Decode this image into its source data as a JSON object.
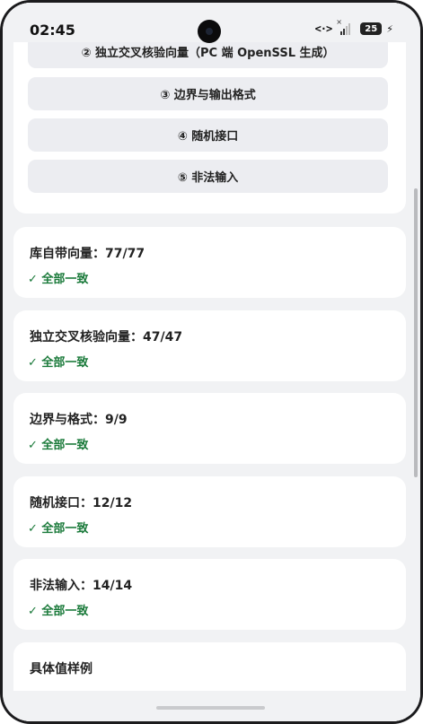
{
  "status_bar": {
    "time": "02:45",
    "data_arrows": "<·>",
    "no_signal_mark": "×",
    "battery": "25",
    "charging_symbol": "⚡"
  },
  "nav_buttons": [
    {
      "label": "② 独立交叉核验向量（PC 端 OpenSSL 生成）"
    },
    {
      "label": "③ 边界与输出格式"
    },
    {
      "label": "④ 随机接口"
    },
    {
      "label": "⑤ 非法输入"
    }
  ],
  "results": [
    {
      "title": "库自带向量：77/77",
      "status": "✓ 全部一致"
    },
    {
      "title": "独立交叉核验向量：47/47",
      "status": "✓ 全部一致"
    },
    {
      "title": "边界与格式：9/9",
      "status": "✓ 全部一致"
    },
    {
      "title": "随机接口：12/12",
      "status": "✓ 全部一致"
    },
    {
      "title": "非法输入：14/14",
      "status": "✓ 全部一致"
    }
  ],
  "samples_card": {
    "title": "具体值样例"
  },
  "colors": {
    "background": "#f1f2f4",
    "card": "#ffffff",
    "button": "#ecedf1",
    "success": "#1a7a3a"
  }
}
